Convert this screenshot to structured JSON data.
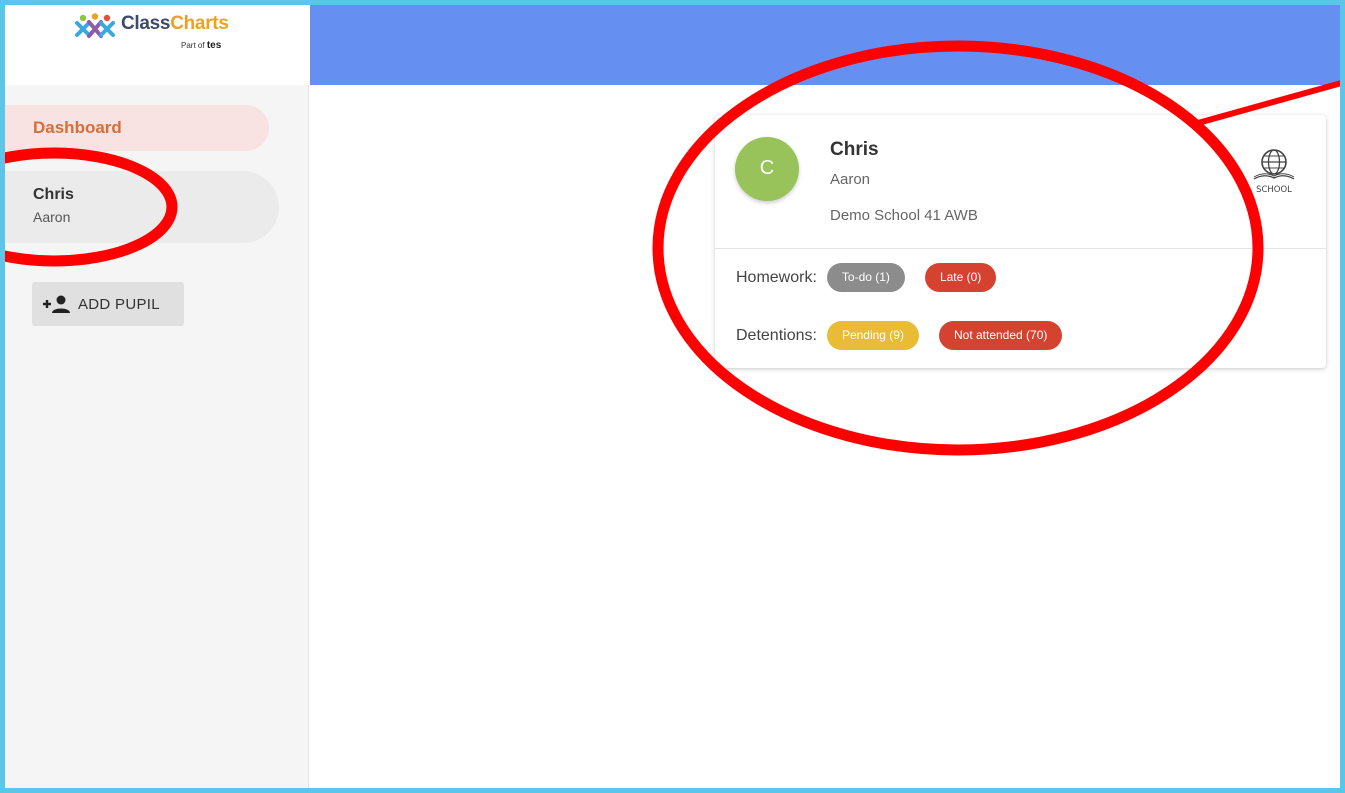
{
  "app": {
    "logo_text_1": "Class",
    "logo_text_2": "Charts",
    "logo_tag_prefix": "Part of",
    "logo_tag_brand": "tes"
  },
  "sidebar": {
    "dashboard_label": "Dashboard",
    "pupil": {
      "first_name": "Chris",
      "last_name": "Aaron"
    },
    "add_pupil_label": "ADD PUPIL"
  },
  "card": {
    "avatar_initial": "C",
    "first_name": "Chris",
    "last_name": "Aaron",
    "school": "Demo School 41 AWB",
    "school_logo_text": "SCHOOL",
    "homework": {
      "label": "Homework:",
      "todo": "To-do (1)",
      "late": "Late (0)"
    },
    "detentions": {
      "label": "Detentions:",
      "pending": "Pending (9)",
      "not_attended": "Not attended (70)"
    }
  },
  "colors": {
    "topbar": "#658ff0",
    "frame_border": "#5cc6e8",
    "dashboard_text": "#d56f3a",
    "avatar": "#97c35a",
    "chip_gray": "#8c8c8c",
    "chip_red": "#d64230",
    "chip_yellow": "#eabb35",
    "annotation_red": "#ff0000"
  },
  "icons": {
    "logo": "classcharts-people-icon",
    "add_pupil": "person-add-icon",
    "school": "globe-book-icon"
  }
}
